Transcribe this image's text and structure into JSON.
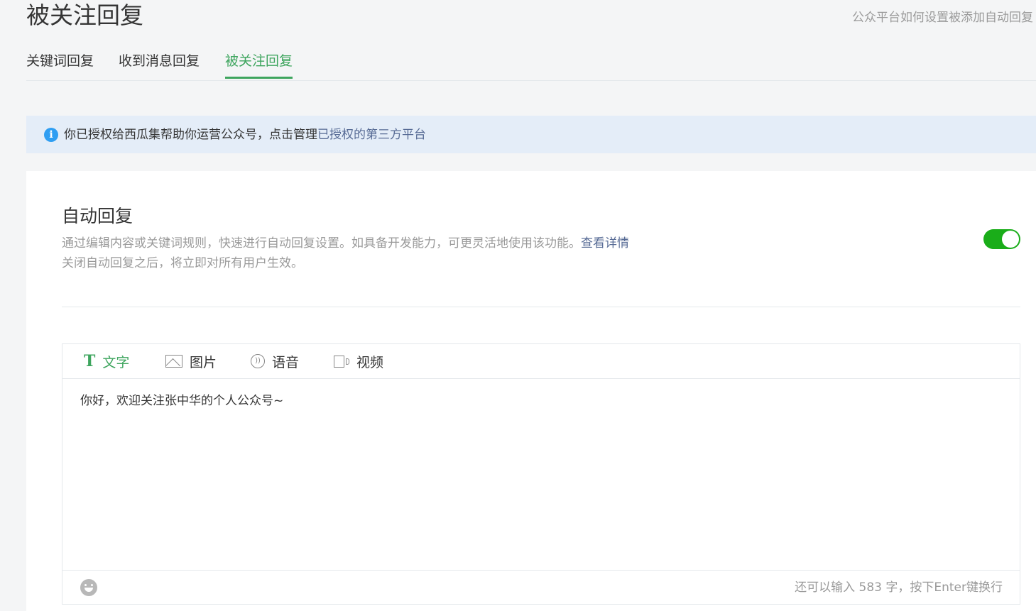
{
  "header": {
    "title": "被关注回复",
    "help_link": "公众平台如何设置被添加自动回复"
  },
  "tabs": [
    {
      "label": "关键词回复",
      "active": false
    },
    {
      "label": "收到消息回复",
      "active": false
    },
    {
      "label": "被关注回复",
      "active": true
    }
  ],
  "notice": {
    "icon": "info-icon",
    "text": "你已授权给西瓜集帮助你运营公众号，点击管理",
    "link": "已授权的第三方平台"
  },
  "auto_reply": {
    "title": "自动回复",
    "description": "通过编辑内容或关键词规则，快速进行自动回复设置。如具备开发能力，可更灵活地使用该功能。",
    "detail_link": "查看详情",
    "note": "关闭自动回复之后，将立即对所有用户生效。",
    "enabled": true
  },
  "editor": {
    "types": [
      {
        "label": "文字",
        "icon": "text-icon",
        "active": true
      },
      {
        "label": "图片",
        "icon": "image-icon",
        "active": false
      },
      {
        "label": "语音",
        "icon": "voice-icon",
        "active": false
      },
      {
        "label": "视频",
        "icon": "video-icon",
        "active": false
      }
    ],
    "content": "你好，欢迎关注张中华的个人公众号~",
    "counter": "还可以输入 583 字，按下Enter键换行",
    "emoji_icon": "emoji-icon"
  },
  "colors": {
    "accent": "#3ea55e",
    "toggle_on": "#1aad19",
    "link": "#576b95",
    "notice_bg": "#e4edf8",
    "info_icon": "#2f9ef2"
  }
}
